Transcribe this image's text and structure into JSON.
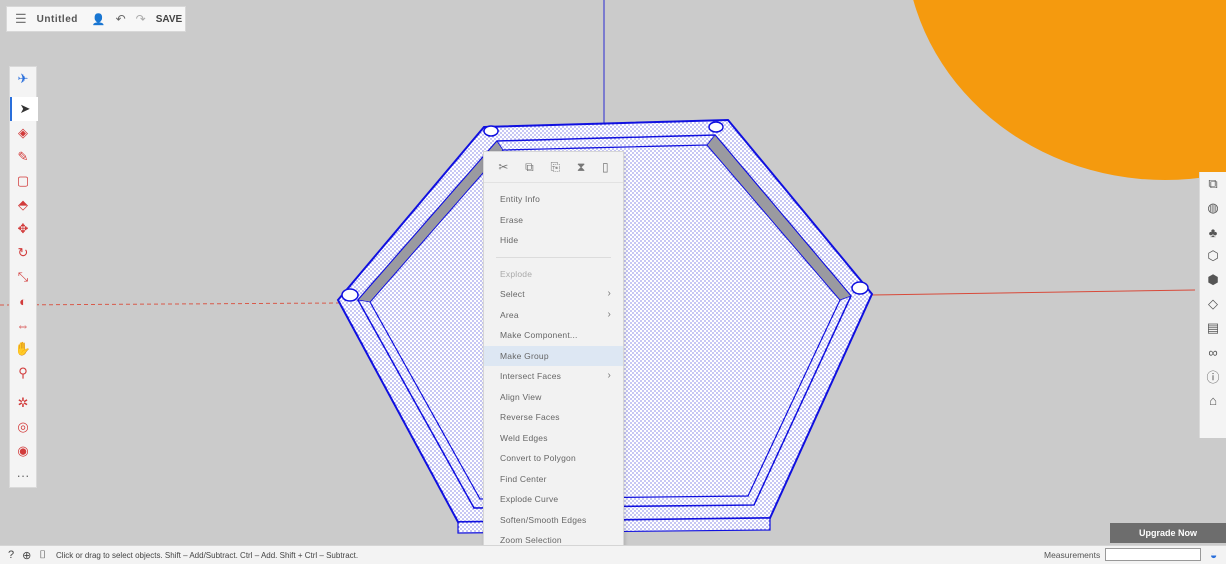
{
  "toolbar": {
    "menu_icon": "menu-icon",
    "title": "Untitled",
    "save_label": "SAVE"
  },
  "left_tools": [
    {
      "name": "select-tool-icon",
      "glyph": "➤"
    },
    {
      "name": "eraser-tool-icon",
      "glyph": "◈"
    },
    {
      "name": "pencil-tool-icon",
      "glyph": "✎"
    },
    {
      "name": "rectangle-tool-icon",
      "glyph": "▢"
    },
    {
      "name": "push-pull-tool-icon",
      "glyph": "⬘"
    },
    {
      "name": "move-tool-icon",
      "glyph": "✥"
    },
    {
      "name": "rotate-tool-icon",
      "glyph": "↻"
    },
    {
      "name": "scale-tool-icon",
      "glyph": "⤡"
    },
    {
      "name": "paint-bucket-icon",
      "glyph": "◐"
    },
    {
      "name": "orbit-tool-icon",
      "glyph": "⇔"
    },
    {
      "name": "pan-tool-icon",
      "glyph": "✋"
    },
    {
      "name": "zoom-tool-icon",
      "glyph": "⚲"
    },
    {
      "name": "zoom-extents-icon",
      "glyph": "✲"
    },
    {
      "name": "walk-tool-icon",
      "glyph": "◎"
    },
    {
      "name": "look-around-icon",
      "glyph": "◉"
    },
    {
      "name": "more-tools-icon",
      "glyph": "···"
    }
  ],
  "right_tools": [
    {
      "name": "components-icon",
      "glyph": "⧉"
    },
    {
      "name": "materials-icon",
      "glyph": "◍"
    },
    {
      "name": "styles-icon",
      "glyph": "♣"
    },
    {
      "name": "layers-icon",
      "glyph": "⬡"
    },
    {
      "name": "scenes-icon",
      "glyph": "⬢"
    },
    {
      "name": "display-icon",
      "glyph": "◇"
    },
    {
      "name": "export-icon",
      "glyph": "▤"
    },
    {
      "name": "glasses-icon",
      "glyph": "∞"
    },
    {
      "name": "info-icon",
      "glyph": "ⓘ"
    },
    {
      "name": "warehouse-icon",
      "glyph": "⌂"
    }
  ],
  "context_menu": {
    "tools": [
      "✂",
      "⧉",
      "⎘",
      "⧗",
      "▯"
    ],
    "items": [
      {
        "label": "Entity Info",
        "disabled": false,
        "submenu": false,
        "highlight": false
      },
      {
        "label": "Erase",
        "disabled": false,
        "submenu": false,
        "highlight": false
      },
      {
        "label": "Hide",
        "disabled": false,
        "submenu": false,
        "highlight": false
      },
      {
        "label": "Explode",
        "disabled": true,
        "submenu": false,
        "highlight": false,
        "divider_before": true
      },
      {
        "label": "Select",
        "disabled": false,
        "submenu": true,
        "highlight": false
      },
      {
        "label": "Area",
        "disabled": false,
        "submenu": true,
        "highlight": false
      },
      {
        "label": "Make Component...",
        "disabled": false,
        "submenu": false,
        "highlight": false
      },
      {
        "label": "Make Group",
        "disabled": false,
        "submenu": false,
        "highlight": true
      },
      {
        "label": "Intersect Faces",
        "disabled": false,
        "submenu": true,
        "highlight": false
      },
      {
        "label": "Align View",
        "disabled": false,
        "submenu": false,
        "highlight": false
      },
      {
        "label": "Reverse Faces",
        "disabled": false,
        "submenu": false,
        "highlight": false
      },
      {
        "label": "Weld Edges",
        "disabled": false,
        "submenu": false,
        "highlight": false
      },
      {
        "label": "Convert to Polygon",
        "disabled": false,
        "submenu": false,
        "highlight": false
      },
      {
        "label": "Find Center",
        "disabled": false,
        "submenu": false,
        "highlight": false
      },
      {
        "label": "Explode Curve",
        "disabled": false,
        "submenu": false,
        "highlight": false
      },
      {
        "label": "Soften/Smooth Edges",
        "disabled": false,
        "submenu": false,
        "highlight": false
      },
      {
        "label": "Zoom Selection",
        "disabled": false,
        "submenu": false,
        "highlight": false
      }
    ]
  },
  "status": {
    "message": "Click or drag to select objects. Shift – Add/Subtract. Ctrl – Add. Shift + Ctrl – Subtract.",
    "measurements_label": "Measurements",
    "measurements_value": ""
  },
  "upgrade_label": "Upgrade Now",
  "colors": {
    "accent": "#2a6fdb",
    "selection": "#2020e0",
    "orange": "#f59a0e",
    "background": "#cbcbcb"
  }
}
